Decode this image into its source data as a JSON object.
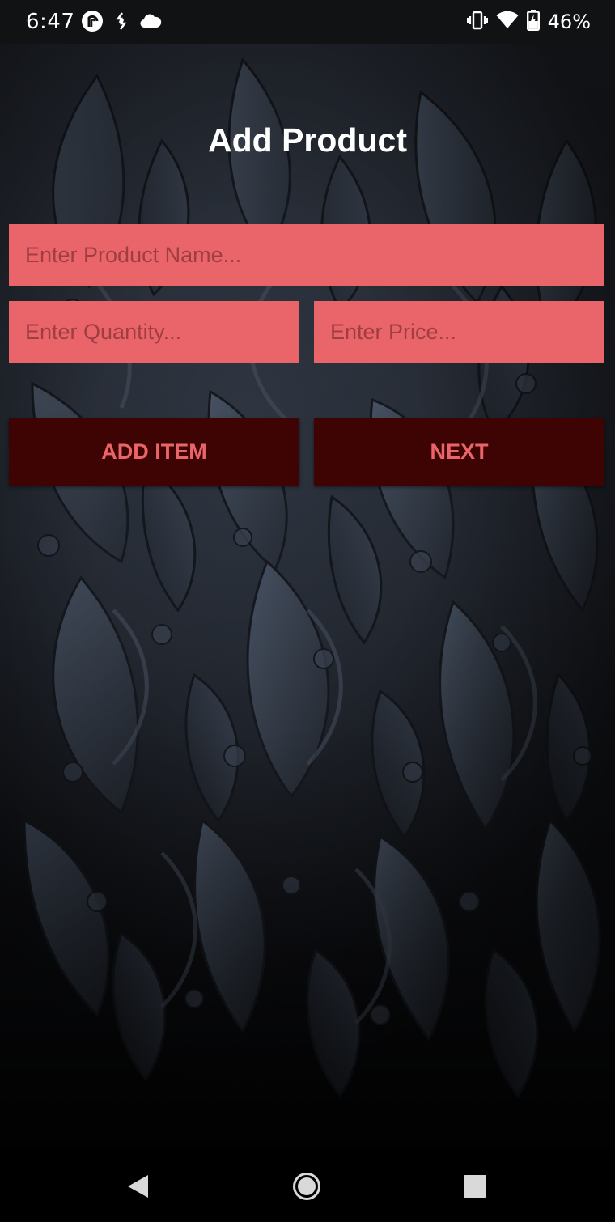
{
  "status_bar": {
    "time": "6:47",
    "left_icons": [
      "pocket-casts-icon",
      "sync-icon",
      "cloud-icon"
    ],
    "right_icons": [
      "vibrate-icon",
      "wifi-icon",
      "battery-charging-icon"
    ],
    "battery_percent": "46%"
  },
  "page": {
    "title": "Add Product"
  },
  "form": {
    "product_name": {
      "value": "",
      "placeholder": "Enter Product Name..."
    },
    "quantity": {
      "value": "",
      "placeholder": "Enter Quantity..."
    },
    "price": {
      "value": "",
      "placeholder": "Enter Price..."
    }
  },
  "actions": {
    "add_item_label": "ADD ITEM",
    "next_label": "NEXT"
  },
  "navigation": {
    "buttons": [
      "back-icon",
      "home-icon",
      "recent-apps-icon"
    ]
  },
  "colors": {
    "field_background": "#ea6569",
    "button_background": "#3e0404",
    "button_text": "#ea6569",
    "title_text": "#ffffff"
  }
}
